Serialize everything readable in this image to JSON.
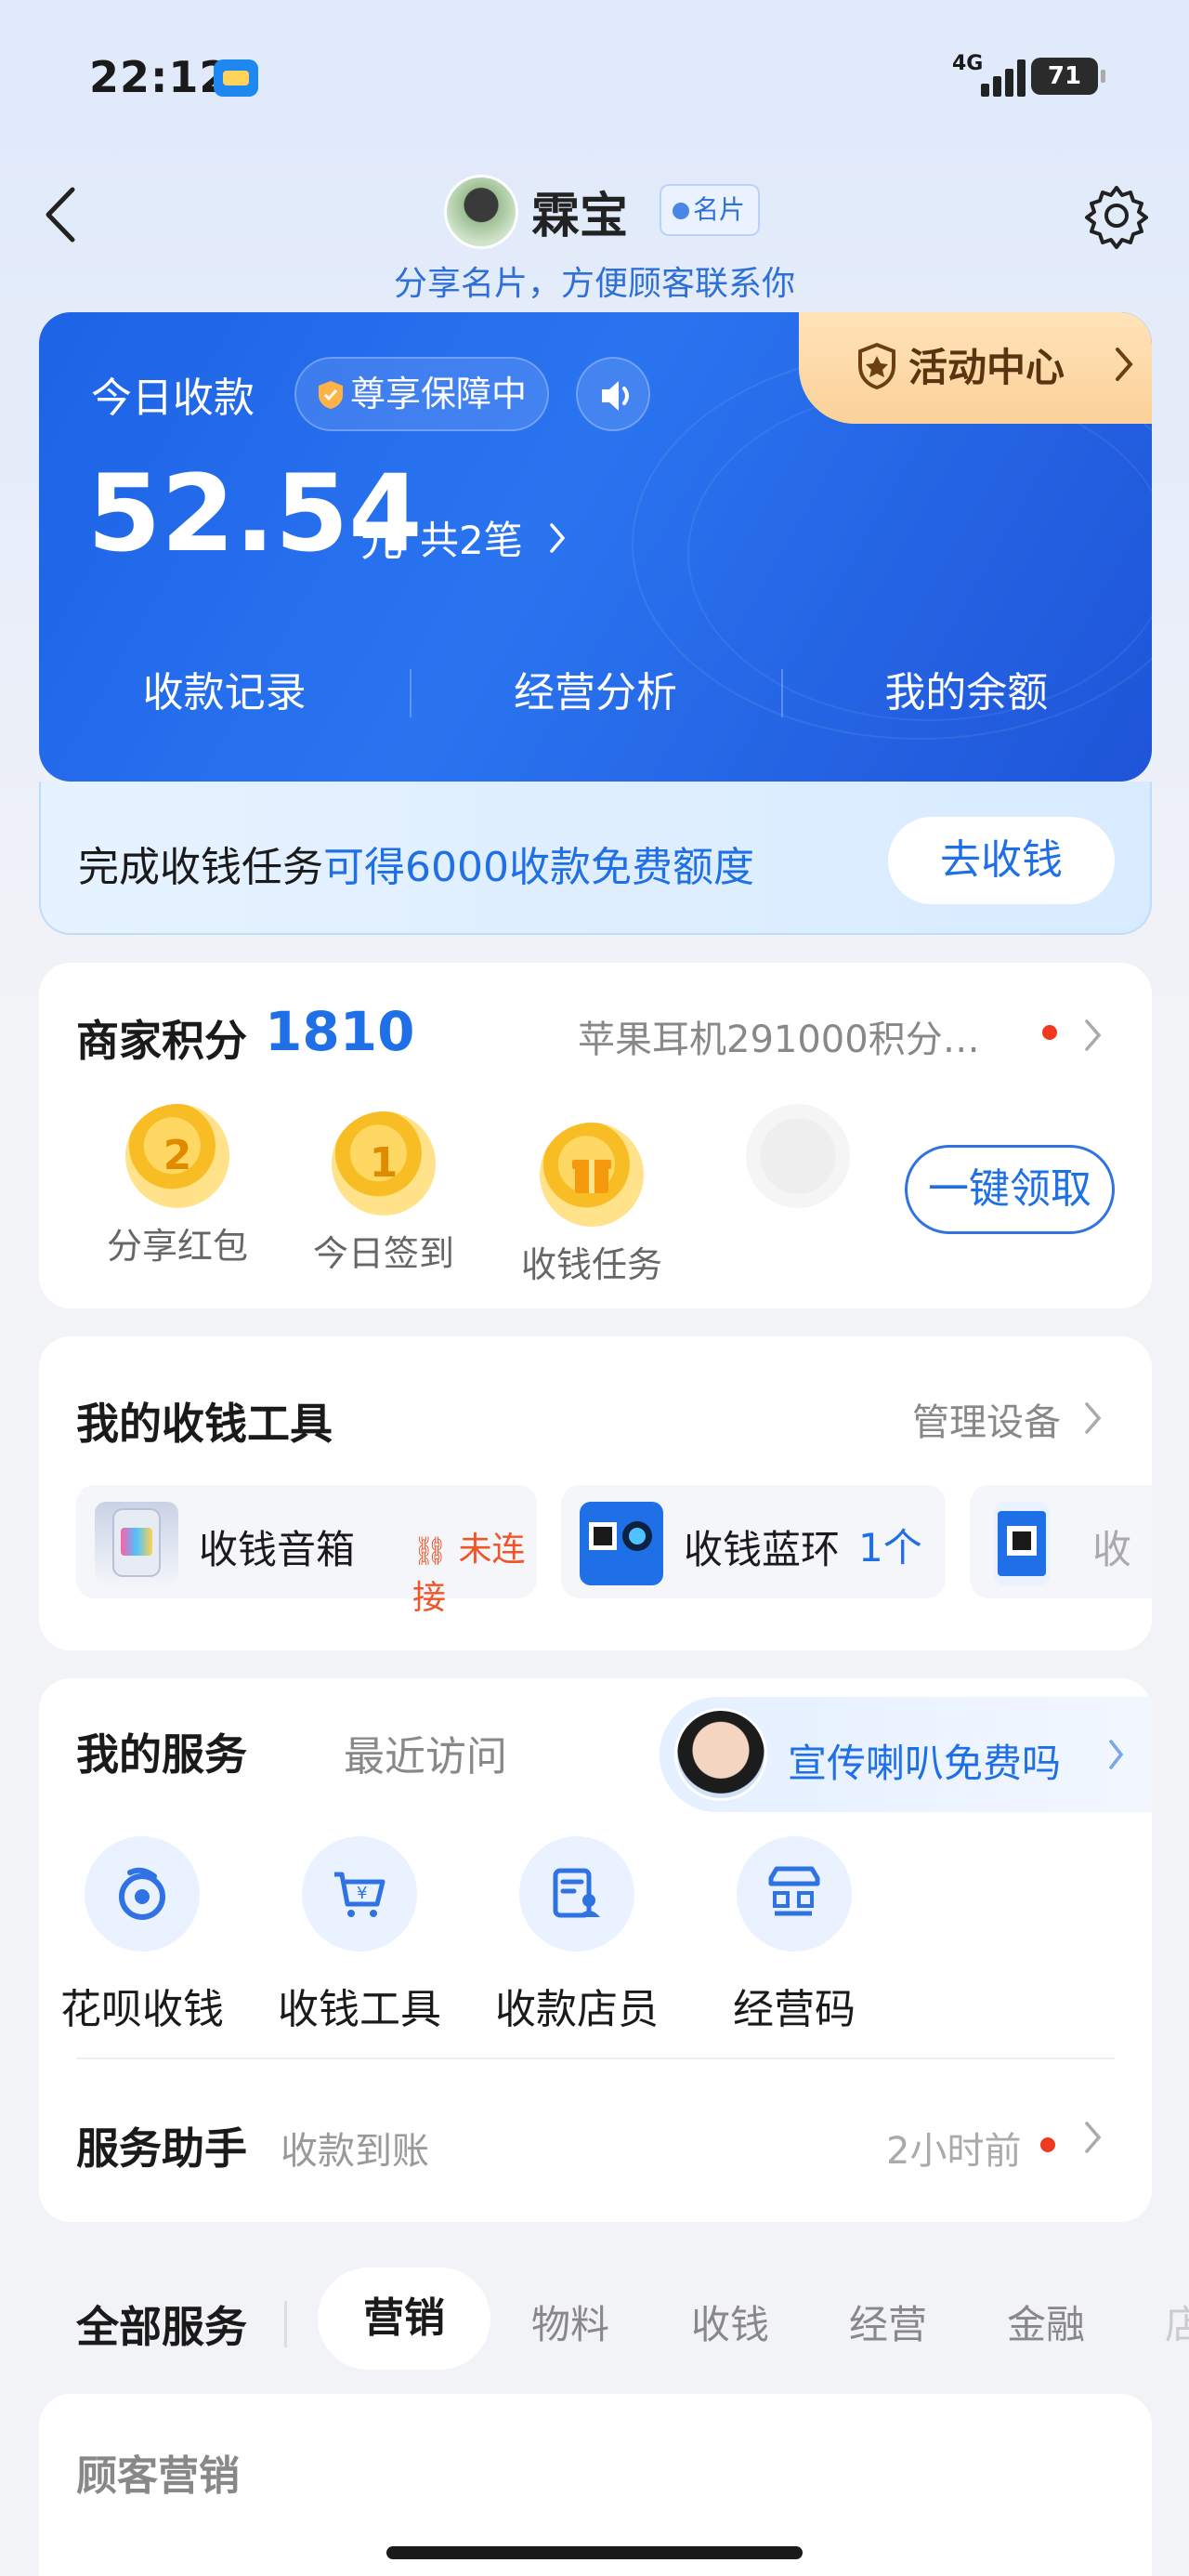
{
  "status": {
    "time": "22:12",
    "network": "4G",
    "battery": "71"
  },
  "header": {
    "name": "霖宝",
    "card_tag": "名片",
    "share_tip": "分享名片，方便顾客联系你"
  },
  "income": {
    "today_label": "今日收款",
    "assurance": "尊享保障中",
    "activity": "活动中心",
    "amount": "52.54",
    "unit": "元",
    "count": "共2笔",
    "quick_links": [
      "收款记录",
      "经营分析",
      "我的余额"
    ]
  },
  "task": {
    "prefix": "完成收钱任务",
    "highlight": "可得6000收款免费额度",
    "button": "去收钱"
  },
  "points": {
    "title": "商家积分",
    "value": "1810",
    "promo": "苹果耳机291000积分…",
    "items": [
      {
        "badge": "2",
        "label": "分享红包"
      },
      {
        "badge": "1",
        "label": "今日签到"
      },
      {
        "badge": "",
        "label": "收钱任务"
      }
    ],
    "claim": "一键领取"
  },
  "tools": {
    "title": "我的收钱工具",
    "manage": "管理设备",
    "items": [
      {
        "name": "收钱音箱",
        "status": "未连接"
      },
      {
        "name": "收钱蓝环",
        "status": "1个"
      },
      {
        "name": "收",
        "status": ""
      }
    ]
  },
  "services": {
    "tab_active": "我的服务",
    "tab_other": "最近访问",
    "promo": "宣传喇叭免费吗",
    "items": [
      "花呗收钱",
      "收钱工具",
      "收款店员",
      "经营码"
    ],
    "assistant": "服务助手",
    "assistant_sub": "收款到账",
    "assistant_time": "2小时前"
  },
  "categories": {
    "title": "全部服务",
    "tabs": [
      "营销",
      "物料",
      "收钱",
      "经营",
      "金融",
      "店"
    ]
  },
  "section": {
    "title": "顾客营销"
  },
  "colors": {
    "accent": "#1f6fe6",
    "card_blue": "#1d63e6",
    "activity_gold": "#fbd19a",
    "alert": "#f0391f"
  }
}
